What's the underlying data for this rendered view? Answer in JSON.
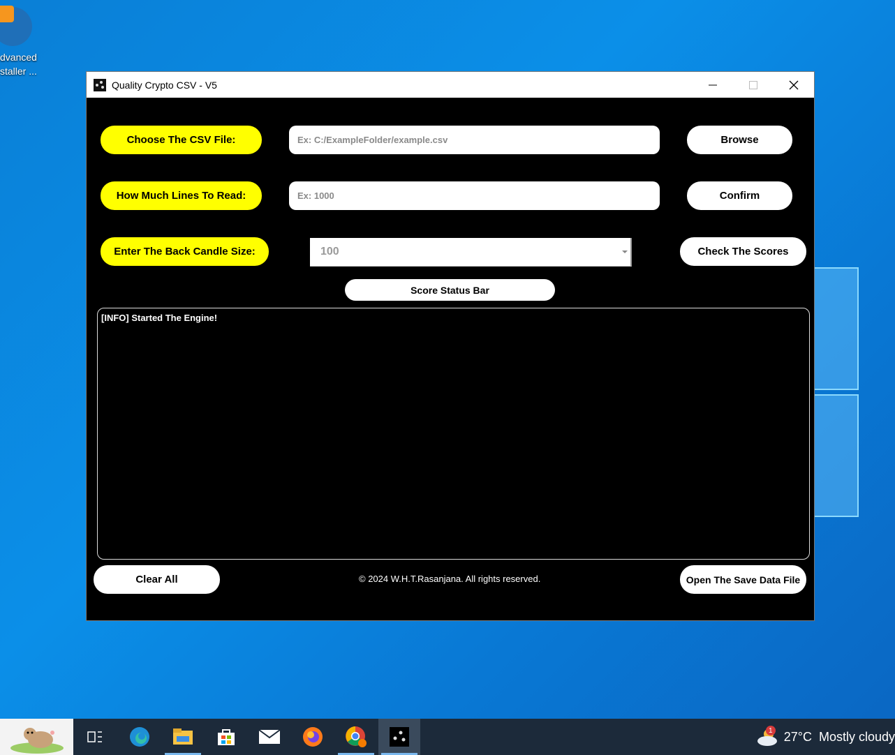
{
  "desktop": {
    "icon_label_line1": "dvanced",
    "icon_label_line2": "staller ..."
  },
  "window": {
    "title": "Quality Crypto CSV - V5"
  },
  "form": {
    "csv_label": "Choose The CSV File:",
    "csv_placeholder": "Ex: C:/ExampleFolder/example.csv",
    "browse_label": "Browse",
    "lines_label": "How Much Lines To Read:",
    "lines_placeholder": "Ex: 1000",
    "confirm_label": "Confirm",
    "candle_label": "Enter The Back Candle Size:",
    "candle_value": "100",
    "check_label": "Check The Scores",
    "status_bar_label": "Score Status Bar"
  },
  "log": {
    "lines": [
      "[INFO] Started The Engine!"
    ]
  },
  "footer": {
    "clear_label": "Clear All",
    "copyright": "© 2024 W.H.T.Rasanjana. All rights reserved.",
    "open_save_label": "Open The Save Data File"
  },
  "taskbar": {
    "items": [
      "task-view",
      "edge",
      "file-explorer",
      "store",
      "mail",
      "firefox",
      "chrome",
      "quality-crypto-csv"
    ],
    "weather_temp": "27°C",
    "weather_desc": "Mostly cloudy",
    "weather_badge": "1"
  },
  "colors": {
    "accent_yellow": "#ffff00",
    "window_bg": "#000000",
    "taskbar_bg": "#1c2a3a"
  }
}
